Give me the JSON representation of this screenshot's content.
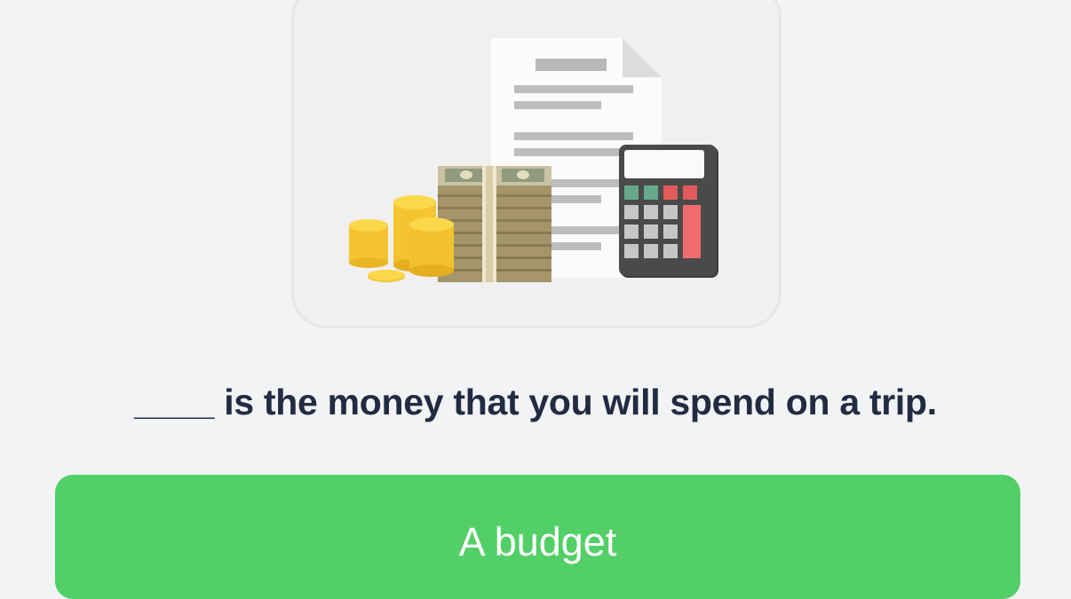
{
  "illustration": {
    "icons": [
      "document-icon",
      "money-stack-icon",
      "coins-icon",
      "calculator-icon"
    ]
  },
  "question": {
    "text": "____ is the money that you will spend on a trip."
  },
  "answer": {
    "label": "A budget"
  },
  "colors": {
    "page_background": "#f2f3f5",
    "card_background": "#f0f0f1",
    "card_border": "#e6e7e9",
    "question_text": "#232b42",
    "answer_background": "#53cf67",
    "answer_text": "#ffffff"
  }
}
